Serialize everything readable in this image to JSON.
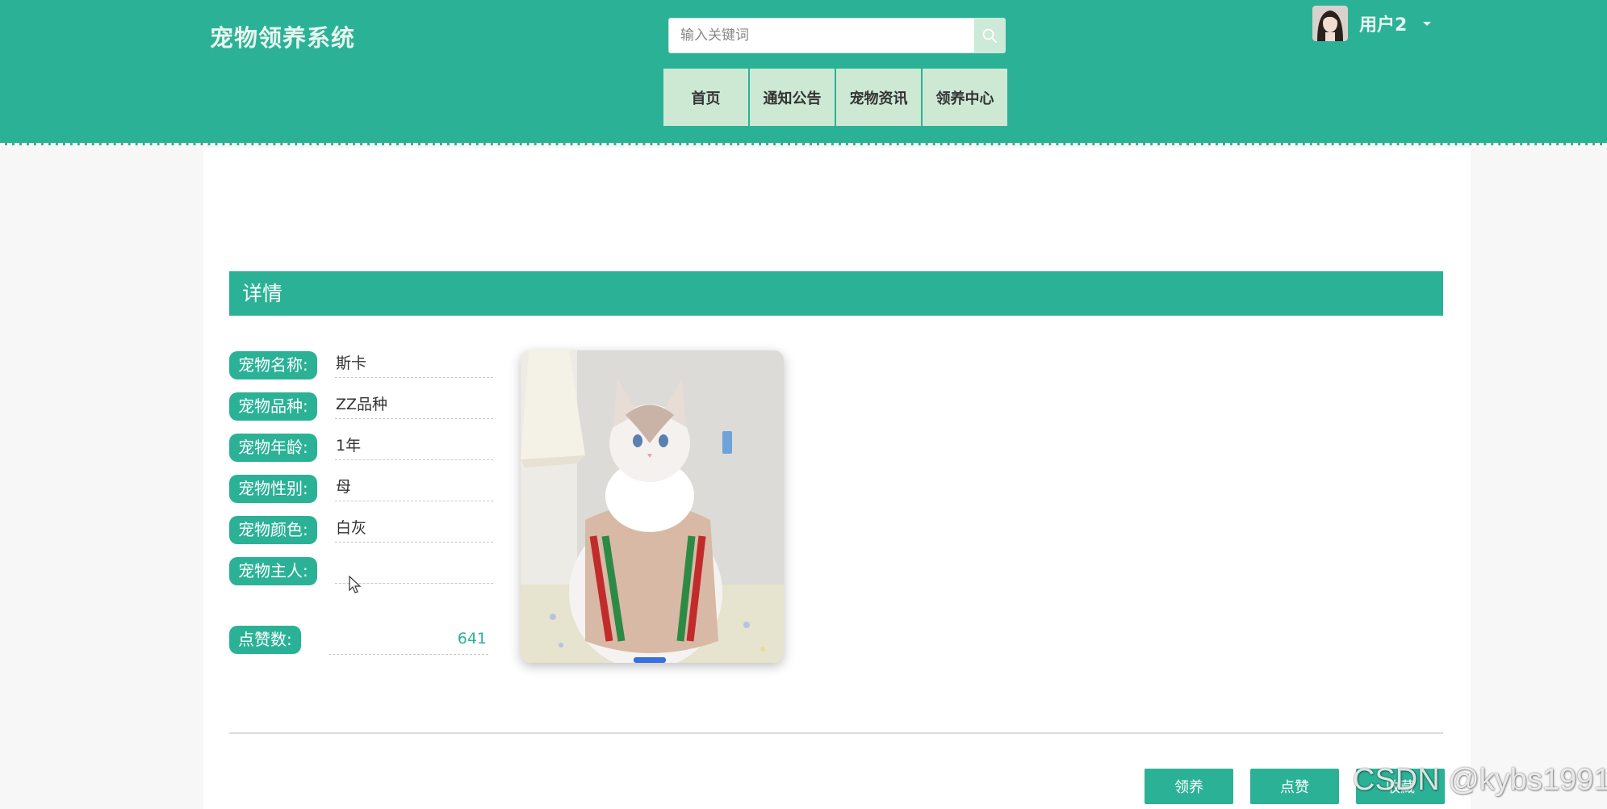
{
  "header": {
    "logo": "宠物领养系统",
    "search": {
      "placeholder": "输入关键词",
      "value": ""
    },
    "nav": [
      {
        "label": "首页"
      },
      {
        "label": "通知公告"
      },
      {
        "label": "宠物资讯"
      },
      {
        "label": "领养中心"
      }
    ],
    "user": {
      "name": "用户2"
    }
  },
  "detail": {
    "section_title": "详情",
    "fields": [
      {
        "label": "宠物名称:",
        "value": "斯卡"
      },
      {
        "label": "宠物品种:",
        "value": "ZZ品种"
      },
      {
        "label": "宠物年龄:",
        "value": "1年"
      },
      {
        "label": "宠物性别:",
        "value": "母"
      },
      {
        "label": "宠物颜色:",
        "value": "白灰"
      },
      {
        "label": "宠物主人:",
        "value": ""
      }
    ],
    "likes": {
      "label": "点赞数:",
      "value": "641"
    }
  },
  "actions": {
    "adopt": "领养",
    "like": "点赞",
    "favorite": "收藏"
  },
  "watermark": "CSDN @kybs1991",
  "colors": {
    "accent": "#2bb296",
    "nav_bg": "#cde9d4"
  },
  "icons": {
    "search": "search-icon",
    "caret": "caret-down-icon",
    "cursor": "mouse-cursor-icon"
  }
}
